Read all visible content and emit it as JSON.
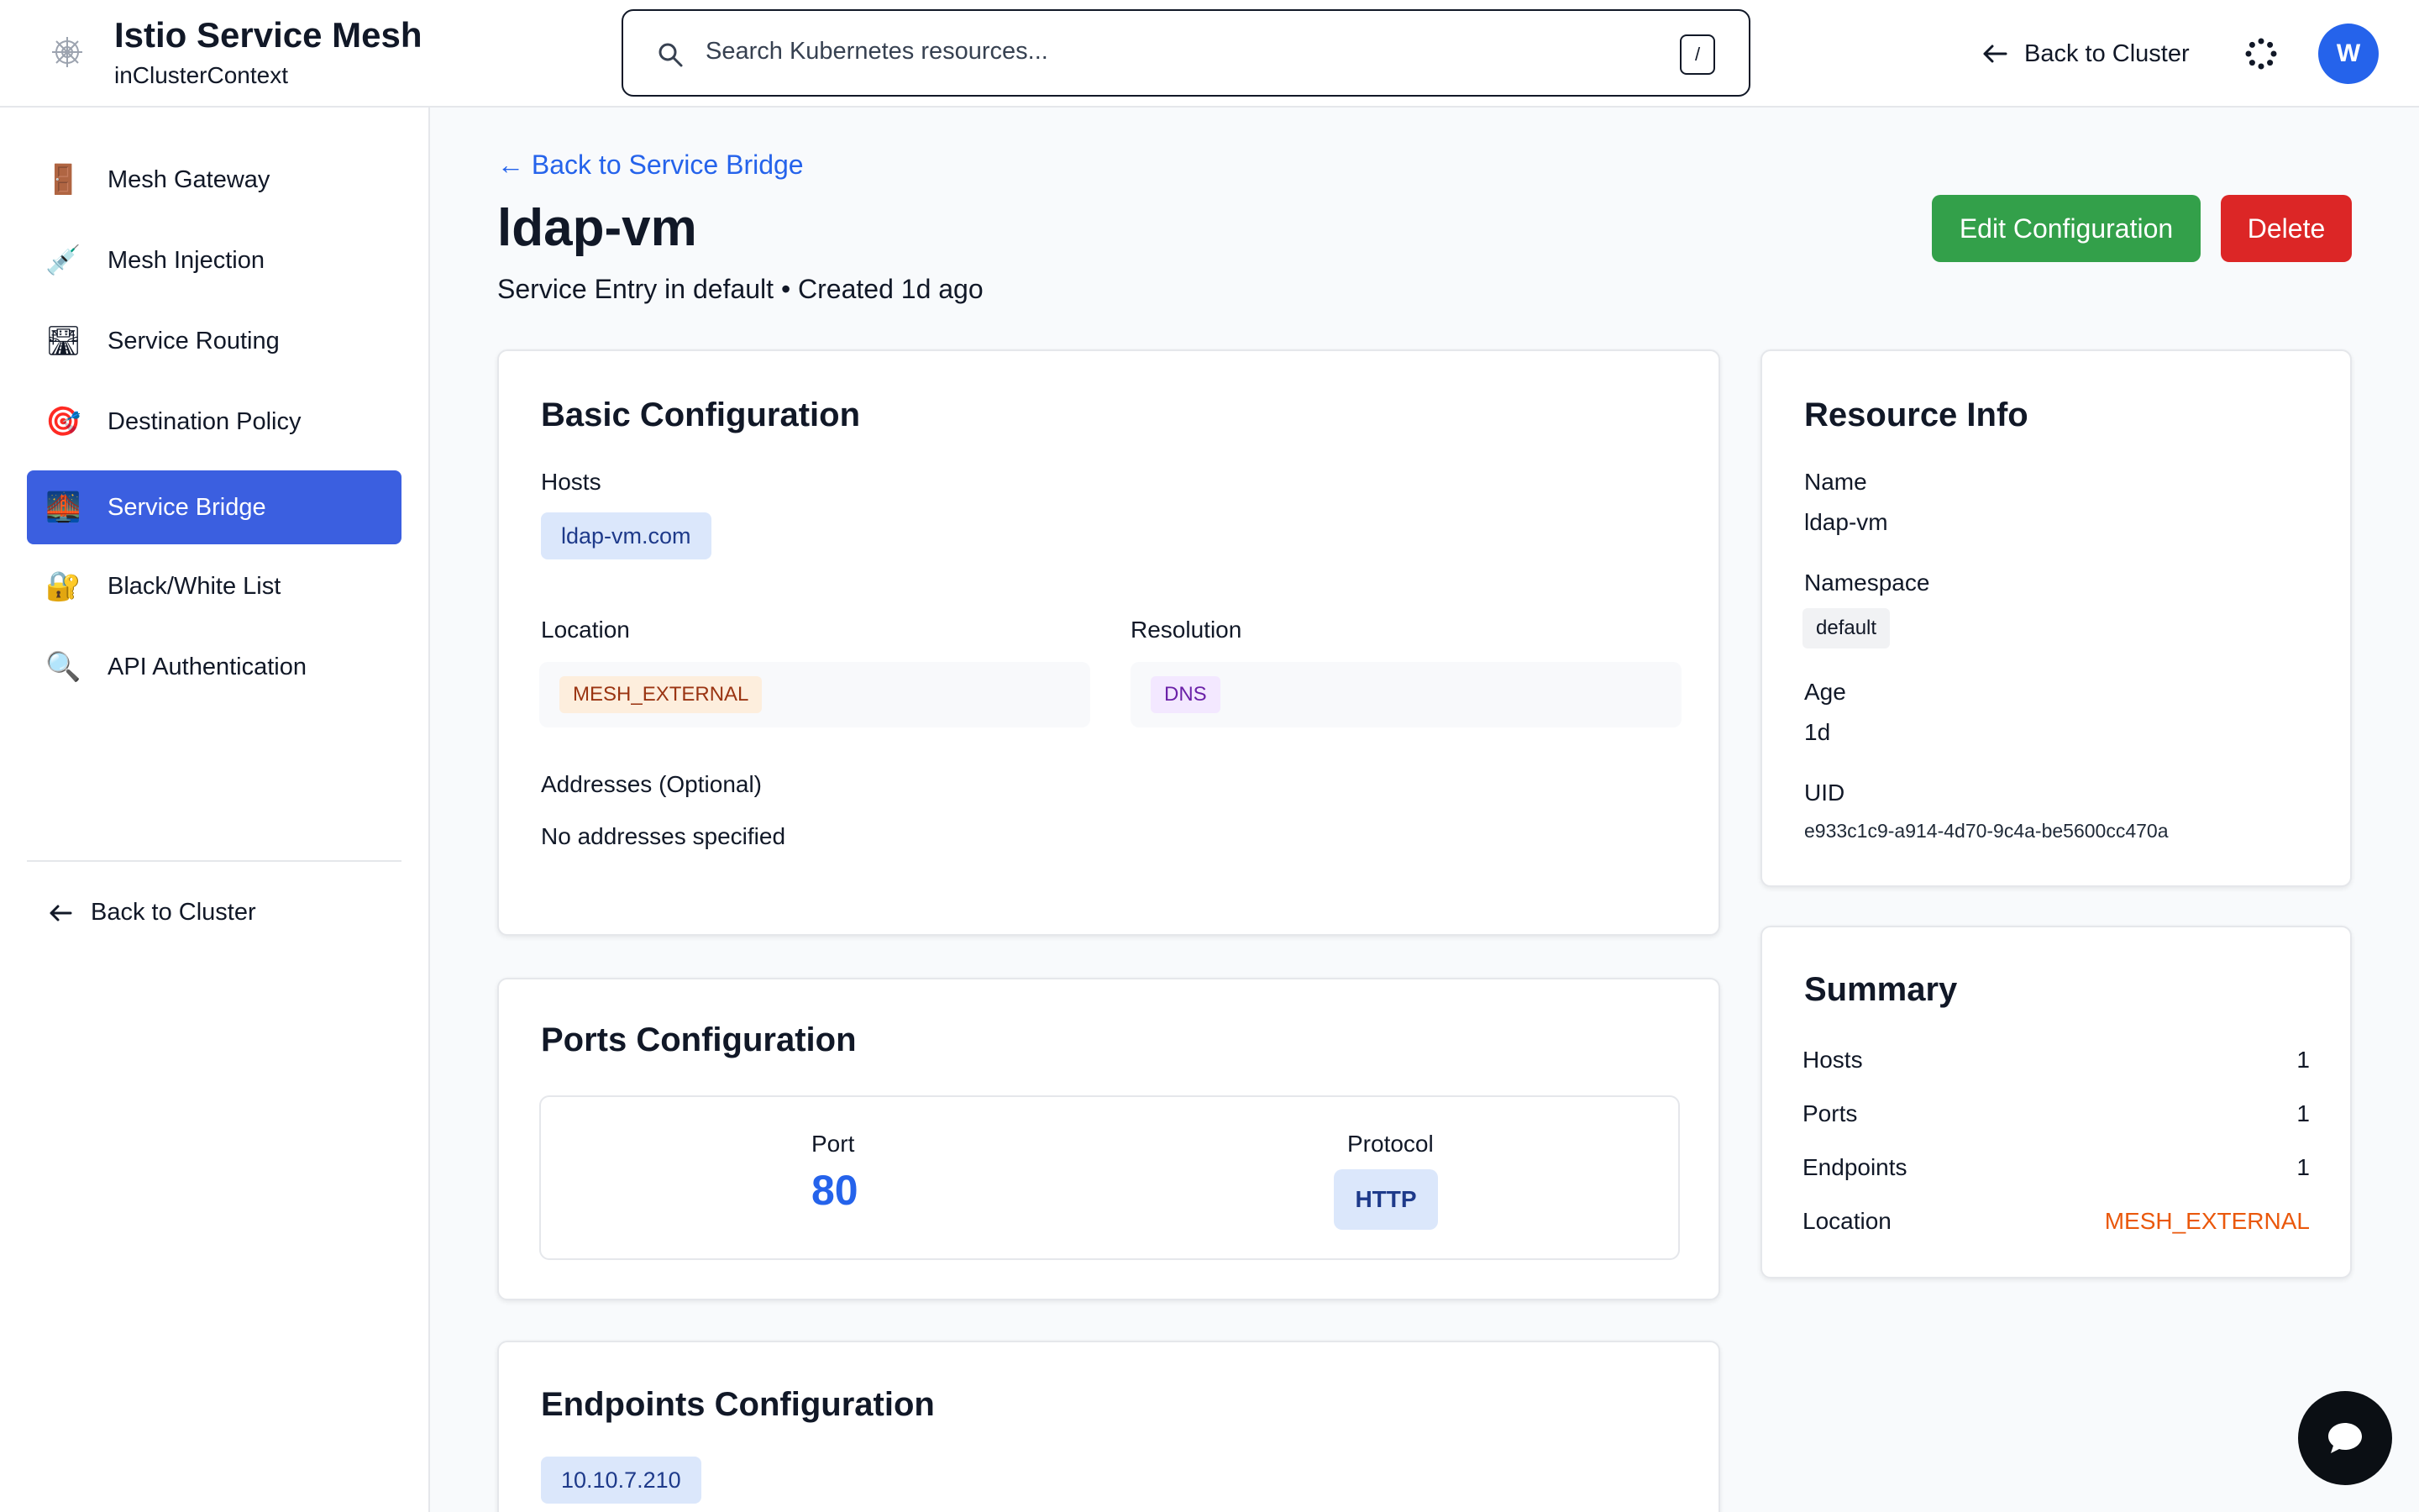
{
  "header": {
    "title": "Istio Service Mesh",
    "context": "inClusterContext",
    "search_placeholder": "Search Kubernetes resources...",
    "search_shortcut": "/",
    "back_label": "Back to Cluster",
    "avatar_initial": "W"
  },
  "sidebar": {
    "items": [
      {
        "label": "Mesh Gateway",
        "icon": "door-icon",
        "glyph": "🚪"
      },
      {
        "label": "Mesh Injection",
        "icon": "syringe-icon",
        "glyph": "💉"
      },
      {
        "label": "Service Routing",
        "icon": "road-icon",
        "glyph": "🛣"
      },
      {
        "label": "Destination Policy",
        "icon": "target-icon",
        "glyph": "🎯"
      },
      {
        "label": "Service Bridge",
        "icon": "bridge-icon",
        "glyph": "🌉",
        "active": true
      },
      {
        "label": "Black/White List",
        "icon": "lock-icon",
        "glyph": "🔐"
      },
      {
        "label": "API Authentication",
        "icon": "magnifier-icon",
        "glyph": "🔍"
      }
    ],
    "back_label": "Back to Cluster"
  },
  "page": {
    "back_link": "← Back to Service Bridge",
    "title": "ldap-vm",
    "subtitle": "Service Entry in default • Created 1d ago",
    "edit_label": "Edit Configuration",
    "delete_label": "Delete"
  },
  "basic": {
    "title": "Basic Configuration",
    "hosts_label": "Hosts",
    "host": "ldap-vm.com",
    "location_label": "Location",
    "location": "MESH_EXTERNAL",
    "resolution_label": "Resolution",
    "resolution": "DNS",
    "addresses_label": "Addresses (Optional)",
    "addresses": "No addresses specified"
  },
  "ports": {
    "title": "Ports Configuration",
    "port_label": "Port",
    "port": "80",
    "protocol_label": "Protocol",
    "protocol": "HTTP"
  },
  "endpoints": {
    "title": "Endpoints Configuration",
    "address": "10.10.7.210"
  },
  "resource": {
    "title": "Resource Info",
    "name_label": "Name",
    "name": "ldap-vm",
    "namespace_label": "Namespace",
    "namespace": "default",
    "age_label": "Age",
    "age": "1d",
    "uid_label": "UID",
    "uid": "e933c1c9-a914-4d70-9c4a-be5600cc470a"
  },
  "summary": {
    "title": "Summary",
    "rows": [
      {
        "label": "Hosts",
        "value": "1"
      },
      {
        "label": "Ports",
        "value": "1"
      },
      {
        "label": "Endpoints",
        "value": "1"
      },
      {
        "label": "Location",
        "value": "MESH_EXTERNAL"
      }
    ]
  },
  "colors": {
    "accent": "#2563eb",
    "active_nav": "#3b5fe0",
    "edit": "#33a04a",
    "delete": "#dc2626",
    "location_text": "#ea580c"
  }
}
